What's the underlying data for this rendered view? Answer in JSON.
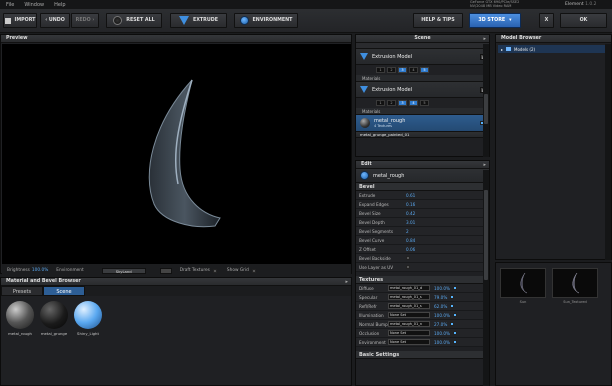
{
  "menu": {
    "file": "File",
    "window": "Window",
    "help": "Help"
  },
  "system": {
    "gpu_line1": "GeForce GTX 690/PCIe/SSE2",
    "gpu_line2": "NV/2048 MB Video RAM",
    "app_name": "Element",
    "version": "1.0.2"
  },
  "toolbar": {
    "import": "IMPORT",
    "undo": "‹ UNDO",
    "redo": "REDO ›",
    "reset": "RESET ALL",
    "extrude": "EXTRUDE",
    "environment": "ENVIRONMENT",
    "help_tips": "HELP & TIPS",
    "store": "3D STORE",
    "close": "X",
    "ok": "OK"
  },
  "preview": {
    "title": "Preview",
    "brightness_label": "Brightness",
    "brightness_value": "100.0%",
    "environment_label": "Environment",
    "environment_value": "SkyLand",
    "draft_label": "Draft Textures",
    "grid_label": "Show Grid"
  },
  "scene": {
    "title": "Scene",
    "extrusion1": "Extrusion Model",
    "extrusion2": "Extrusion Model",
    "nums": [
      "1",
      "2",
      "3",
      "4",
      "5"
    ],
    "materials_label": "Materials",
    "mat_name": "metal_rough",
    "mat_sub": "4 Textures",
    "mat_next": "metal_grunge_painted_01"
  },
  "edit": {
    "title": "Edit",
    "material": "metal_rough",
    "bevel_head": "Bevel",
    "bevel_rows": [
      {
        "label": "Extrude",
        "value": "0.61"
      },
      {
        "label": "Expand Edges",
        "value": "0.16"
      },
      {
        "label": "Bevel Size",
        "value": "0.42"
      },
      {
        "label": "Bevel Depth",
        "value": "3.01"
      },
      {
        "label": "Bevel Segments",
        "value": "2"
      },
      {
        "label": "Bevel Curve",
        "value": "0.84"
      },
      {
        "label": "Z Offset",
        "value": "0.06"
      },
      {
        "label": "Bevel Backside",
        "value": ""
      },
      {
        "label": "Use Layer as UV",
        "value": ""
      }
    ],
    "tex_head": "Textures",
    "tex_rows": [
      {
        "label": "Diffuse",
        "tex": "metal_rough_01_d",
        "pct": "100.0%"
      },
      {
        "label": "Specular",
        "tex": "metal_rough_01_s",
        "pct": "79.0%"
      },
      {
        "label": "Refl/Refr",
        "tex": "metal_rough_01_s",
        "pct": "62.0%"
      },
      {
        "label": "Illumination",
        "tex": "None Set",
        "pct": "100.0%"
      },
      {
        "label": "Normal Bump",
        "tex": "metal_rough_01_n",
        "pct": "27.0%"
      },
      {
        "label": "Occlusion",
        "tex": "None Set",
        "pct": "100.0%"
      },
      {
        "label": "Environment",
        "tex": "None Set",
        "pct": "100.0%"
      }
    ],
    "basic_head": "Basic Settings"
  },
  "model_browser": {
    "title": "Model Browser",
    "tree_item": "Models (2)",
    "thumb1": "Sun",
    "thumb2": "Sun_Textured"
  },
  "mat_browser": {
    "title": "Material and Bevel Browser",
    "tab_presets": "Presets",
    "tab_scene": "Scene",
    "items": [
      "metal_rough",
      "metal_grunge",
      "Shiny_Light"
    ]
  }
}
